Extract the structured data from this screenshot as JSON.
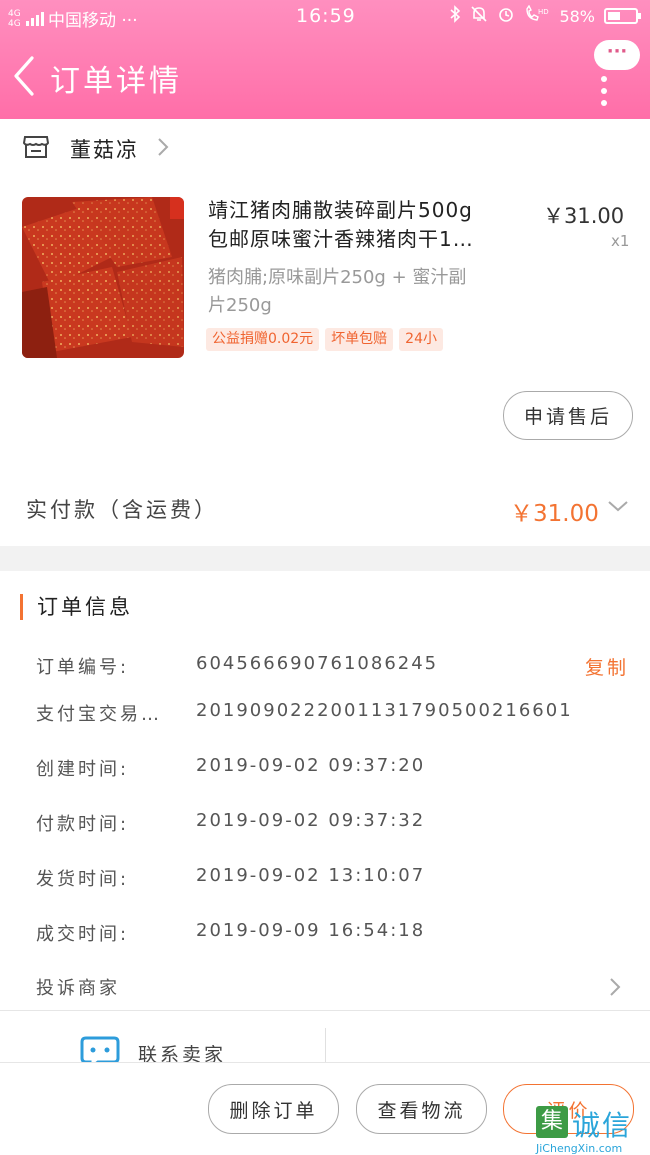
{
  "status_bar": {
    "network": "4G 4G",
    "carrier": "中国移动 ···",
    "time": "16:59",
    "battery": "58%"
  },
  "nav": {
    "title": "订单详情",
    "more_label": "···"
  },
  "shop": {
    "name": "董菇凉"
  },
  "product": {
    "title_line1": "靖江猪肉脯散装碎副片500g",
    "title_line2": "包邮原味蜜汁香辣猪肉干1…",
    "price": "￥31.00",
    "quantity": "x1",
    "sku_line1": "猪肉脯;原味副片250g + 蜜汁副",
    "sku_line2": "片250g",
    "tags": [
      "公益捐赠0.02元",
      "坏单包赔",
      "24小"
    ]
  },
  "after_sale_button": "申请售后",
  "payment": {
    "label": "实付款（含运费）",
    "amount": "￥31.00"
  },
  "order_info": {
    "section_title": "订单信息",
    "copy_label": "复制",
    "rows": [
      {
        "label": "订单编号:",
        "value": "604566690761086245"
      },
      {
        "label": "支付宝交易…",
        "value": "2019090222001131790500216601"
      },
      {
        "label": "创建时间:",
        "value": "2019-09-02 09:37:20"
      },
      {
        "label": "付款时间:",
        "value": "2019-09-02 09:37:32"
      },
      {
        "label": "发货时间:",
        "value": "2019-09-02 13:10:07"
      },
      {
        "label": "成交时间:",
        "value": "2019-09-09 16:54:18"
      }
    ],
    "complaint_label": "投诉商家"
  },
  "contact_label": "联系卖家",
  "bottom_actions": {
    "delete": "删除订单",
    "logistics": "查看物流",
    "review": "评价"
  },
  "watermark": {
    "mark": "集",
    "text": "诚信",
    "url": "JiChengXin.com"
  },
  "colors": {
    "header_pink": "#ff7ab0",
    "accent_orange": "#f37332"
  }
}
